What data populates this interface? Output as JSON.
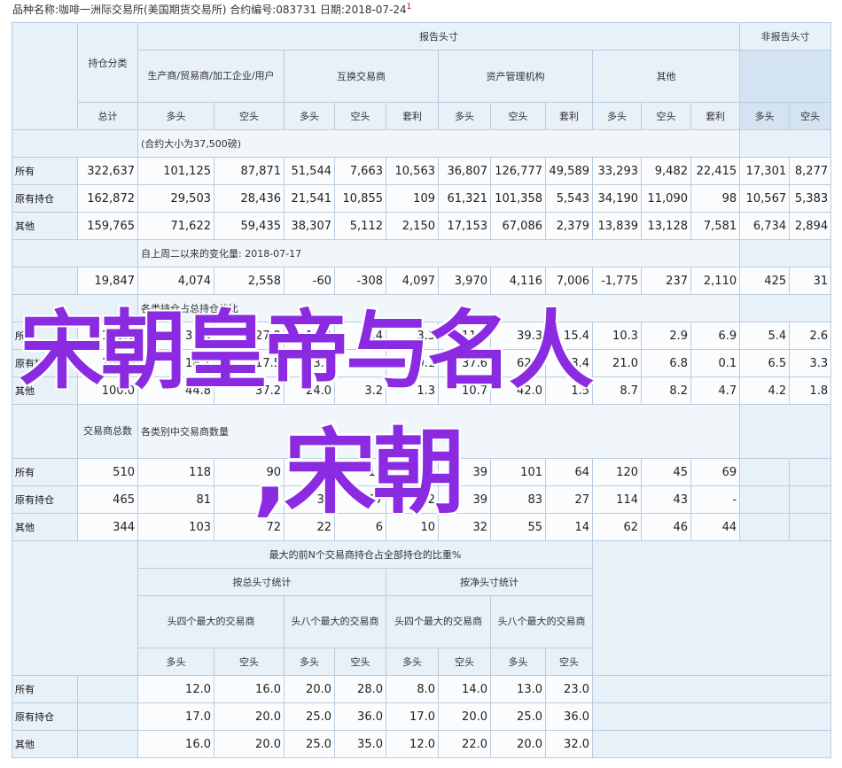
{
  "title": "品种名称:咖啡一洲际交易所(美国期货交易所)    合约编号:083731    日期:2018-07-24",
  "title_mark": "1",
  "head": {
    "reportable": "报告头寸",
    "nonreportable": "非报告头寸",
    "category": "持仓分类",
    "producer": "生产商/贸易商/加工企业/用户",
    "swap": "互换交易商",
    "managed": "资产管理机构",
    "other": "其他",
    "total": "总计",
    "long": "多头",
    "short": "空头",
    "spread": "套利"
  },
  "section1": {
    "note": "(合约大小为37,500磅)",
    "rows": [
      {
        "label": "所有",
        "values": [
          "322,637",
          "101,125",
          "87,871",
          "51,544",
          "7,663",
          "10,563",
          "36,807",
          "126,777",
          "49,589",
          "33,293",
          "9,482",
          "22,415",
          "17,301",
          "8,277"
        ]
      },
      {
        "label": "原有持仓",
        "values": [
          "162,872",
          "29,503",
          "28,436",
          "21,541",
          "10,855",
          "109",
          "61,321",
          "101,358",
          "5,543",
          "34,190",
          "11,090",
          "98",
          "10,567",
          "5,383"
        ]
      },
      {
        "label": "其他",
        "values": [
          "159,765",
          "71,622",
          "59,435",
          "38,307",
          "5,112",
          "2,150",
          "17,153",
          "67,086",
          "2,379",
          "13,839",
          "13,128",
          "7,581",
          "6,734",
          "2,894"
        ]
      }
    ]
  },
  "section2": {
    "note": "自上周二以来的变化量: 2018-07-17",
    "values": [
      "19,847",
      "4,074",
      "2,558",
      "-60",
      "-308",
      "4,097",
      "3,970",
      "4,116",
      "7,006",
      "-1,775",
      "237",
      "2,110",
      "425",
      "31"
    ]
  },
  "section3": {
    "note": "各类持仓占总持仓的比",
    "rows": [
      {
        "label": "所有",
        "values": [
          "100.0",
          "31.3",
          "27.2",
          "16.0",
          "2.4",
          "3.3",
          "11.4",
          "39.3",
          "15.4",
          "10.3",
          "2.9",
          "6.9",
          "5.4",
          "2.6"
        ]
      },
      {
        "label": "原有持仓",
        "values": [
          "100.0",
          "18.1",
          "17.5",
          "13.2",
          "6.7",
          "0.1",
          "37.6",
          "62.2",
          "3.4",
          "21.0",
          "6.8",
          "0.1",
          "6.5",
          "3.3"
        ]
      },
      {
        "label": "其他",
        "values": [
          "100.0",
          "44.8",
          "37.2",
          "24.0",
          "3.2",
          "1.3",
          "10.7",
          "42.0",
          "1.5",
          "8.7",
          "8.2",
          "4.7",
          "4.2",
          "1.8"
        ]
      }
    ]
  },
  "section4": {
    "trader_total": "交易商总数",
    "note": "各类别中交易商数量",
    "rows": [
      {
        "label": "所有",
        "values": [
          "510",
          "118",
          "90",
          "36",
          "17",
          "19",
          "39",
          "101",
          "64",
          "120",
          "45",
          "69",
          "",
          ""
        ]
      },
      {
        "label": "原有持仓",
        "values": [
          "465",
          "81",
          "75",
          "35",
          "17",
          "12",
          "39",
          "83",
          "27",
          "114",
          "43",
          "-",
          "",
          ""
        ]
      },
      {
        "label": "其他",
        "values": [
          "344",
          "103",
          "72",
          "22",
          "6",
          "10",
          "32",
          "55",
          "14",
          "62",
          "46",
          "44",
          "",
          ""
        ]
      }
    ]
  },
  "section5": {
    "header": "最大的前N个交易商持仓占全部持仓的比重%",
    "by_gross": "按总头寸统计",
    "by_net": "按净头寸统计",
    "top4": "头四个最大的交易商",
    "top8": "头八个最大的交易商",
    "long": "多头",
    "short": "空头",
    "rows": [
      {
        "label": "所有",
        "values": [
          "12.0",
          "16.0",
          "20.0",
          "28.0",
          "8.0",
          "14.0",
          "13.0",
          "23.0"
        ]
      },
      {
        "label": "原有持仓",
        "values": [
          "17.0",
          "20.0",
          "25.0",
          "36.0",
          "17.0",
          "20.0",
          "25.0",
          "36.0"
        ]
      },
      {
        "label": "其他",
        "values": [
          "16.0",
          "20.0",
          "25.0",
          "35.0",
          "12.0",
          "22.0",
          "20.0",
          "32.0"
        ]
      }
    ]
  },
  "overlay": {
    "line1": "宋朝皇帝与名人",
    "line2": ",宋朝"
  }
}
